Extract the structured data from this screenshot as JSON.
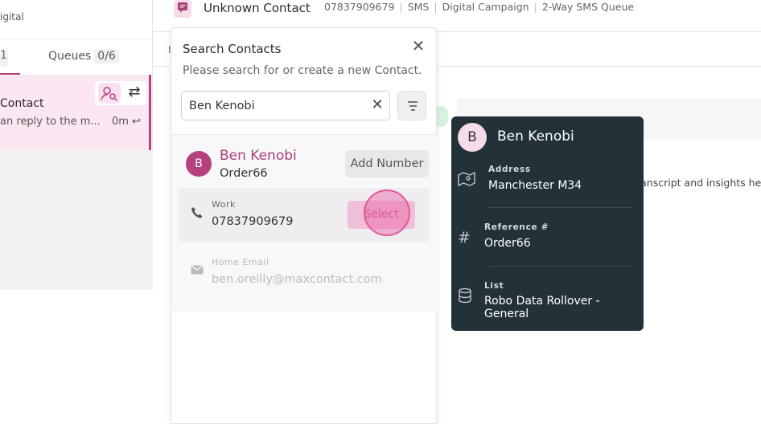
{
  "left": {
    "brand": "igital",
    "tab_active": "1",
    "queues_label": "Queues",
    "queues_count": "0/6",
    "conversation": {
      "name": "Contact",
      "preview": "an reply to the m...",
      "time": "0m"
    }
  },
  "header": {
    "title": "Unknown Contact",
    "phone": "07837909679",
    "channel": "SMS",
    "campaign": "Digital Campaign",
    "queue": "2-Way SMS Queue"
  },
  "content": {
    "transcript_text": "ranscript and insights he"
  },
  "search_panel": {
    "title": "Search Contacts",
    "subtitle": "Please search for or create a new Contact.",
    "search_value": "Ben Kenobi",
    "result": {
      "avatar": "B",
      "name": "Ben Kenobi",
      "reference": "Order66",
      "add_number_label": "Add Number",
      "work_label": "Work",
      "work_number": "07837909679",
      "select_label": "Select",
      "home_email_label": "Home Email",
      "home_email": "ben.oreilly@maxcontact.com"
    }
  },
  "popover": {
    "avatar": "B",
    "name": "Ben Kenobi",
    "fields": [
      {
        "icon": "map-icon",
        "label": "Address",
        "value": "Manchester M34"
      },
      {
        "icon": "hash-icon",
        "label": "Reference #",
        "value": "Order66"
      },
      {
        "icon": "database-icon",
        "label": "List",
        "value": "Robo Data Rollover - General"
      }
    ]
  },
  "colors": {
    "brand": "#b7407e",
    "popover_bg": "#233238",
    "select_bg": "#eec0d7"
  }
}
